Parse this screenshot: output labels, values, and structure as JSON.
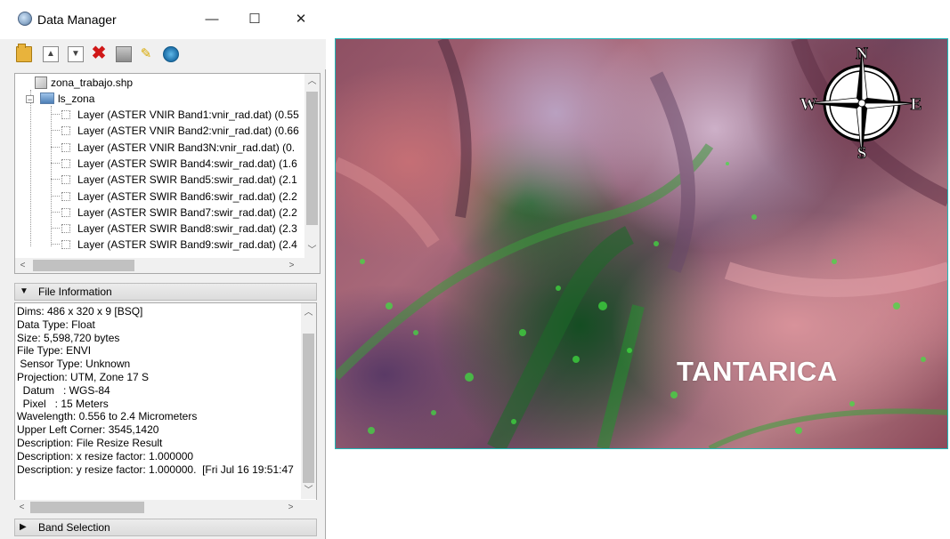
{
  "window": {
    "title": "Data Manager",
    "controls": {
      "minimize": "—",
      "maximize": "☐",
      "close": "✕"
    }
  },
  "toolbar": {
    "buttons": [
      {
        "name": "open-file",
        "icon": "folder-icon"
      },
      {
        "name": "move-up",
        "icon": "up-icon"
      },
      {
        "name": "move-down",
        "icon": "down-icon"
      },
      {
        "name": "close-file",
        "icon": "red-x-icon"
      },
      {
        "name": "save",
        "icon": "save-icon"
      },
      {
        "name": "pin",
        "icon": "pin-icon"
      },
      {
        "name": "link",
        "icon": "link-icon"
      }
    ]
  },
  "tree": {
    "vector_file": "zona_trabajo.shp",
    "raster_file": "ls_zona",
    "layers": [
      "Layer (ASTER VNIR Band1:vnir_rad.dat) (0.55",
      "Layer (ASTER VNIR Band2:vnir_rad.dat) (0.66",
      "Layer (ASTER VNIR Band3N:vnir_rad.dat) (0.",
      "Layer (ASTER SWIR Band4:swir_rad.dat) (1.6",
      "Layer (ASTER SWIR Band5:swir_rad.dat) (2.1",
      "Layer (ASTER SWIR Band6:swir_rad.dat) (2.2",
      "Layer (ASTER SWIR Band7:swir_rad.dat) (2.2",
      "Layer (ASTER SWIR Band8:swir_rad.dat) (2.3",
      "Layer (ASTER SWIR Band9:swir_rad.dat) (2.4"
    ]
  },
  "file_information": {
    "header": "File Information",
    "lines": [
      "Dims: 486 x 320 x 9 [BSQ]",
      "Data Type: Float",
      "Size: 5,598,720 bytes",
      "File Type: ENVI",
      " Sensor Type: Unknown",
      "Projection: UTM, Zone 17 S",
      "  Datum   : WGS-84",
      "  Pixel   : 15 Meters",
      "Wavelength: 0.556 to 2.4 Micrometers",
      "Upper Left Corner: 3545,1420",
      "Description: File Resize Result",
      "Description: x resize factor: 1.000000",
      "Description: y resize factor: 1.000000.  [Fri Jul 16 19:51:47"
    ]
  },
  "band_selection": {
    "header": "Band Selection"
  },
  "map": {
    "label": "TANTARICA",
    "compass": {
      "n": "N",
      "s": "S",
      "e": "E",
      "w": "W"
    },
    "colors": {
      "vegetation": "#2fd02f",
      "soil": "#c9787f",
      "frame": "#20b8b8"
    }
  }
}
